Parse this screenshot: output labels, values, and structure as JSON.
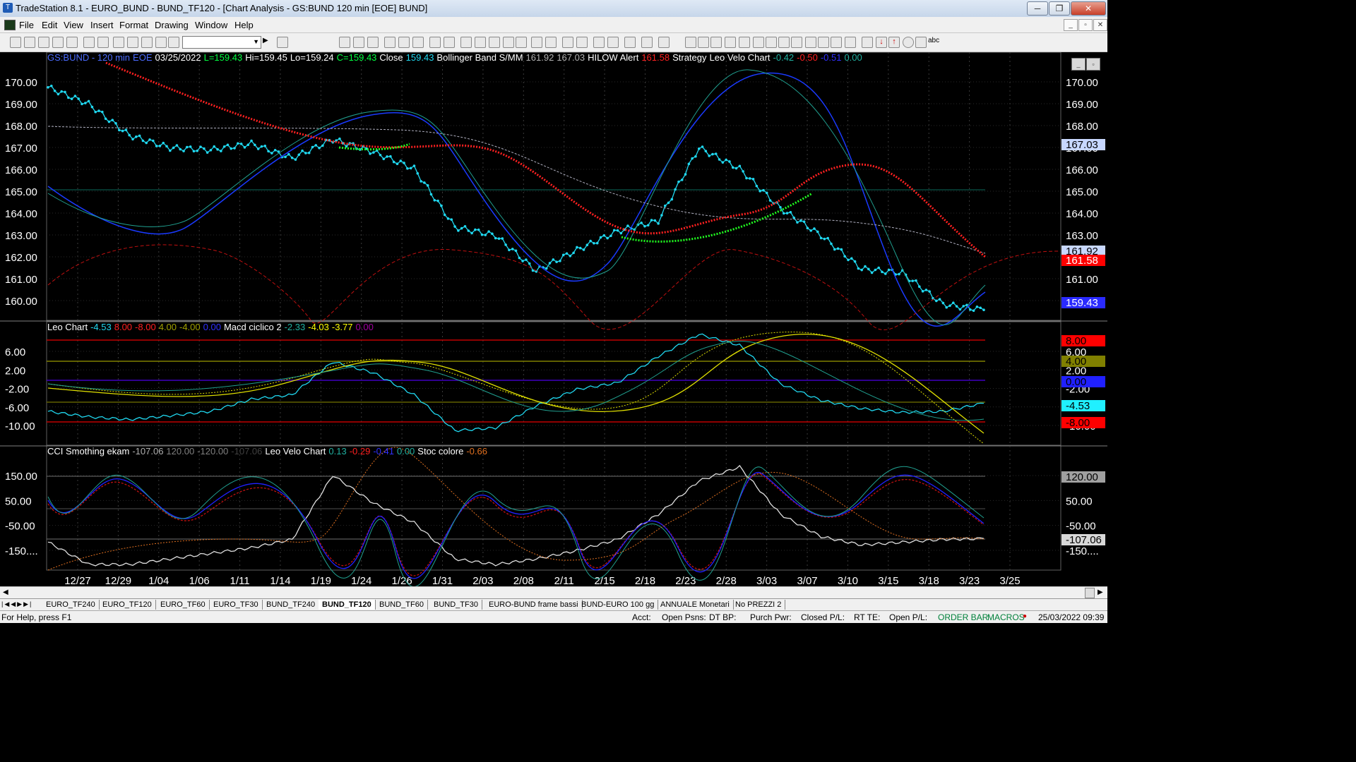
{
  "window": {
    "title": "TradeStation 8.1 - EURO_BUND - BUND_TF120 - [Chart Analysis - GS:BUND  120 min  [EOE] BUND]",
    "minimize": "─",
    "maximize": "❐",
    "close": "✕"
  },
  "menu": [
    "File",
    "Edit",
    "View",
    "Insert",
    "Format",
    "Drawing",
    "Window",
    "Help"
  ],
  "pane1": {
    "legend": [
      {
        "t": "GS:BUND - 120 min",
        "c": "#4a6bff"
      },
      {
        "t": "EOE",
        "c": "#4a6bff"
      },
      {
        "t": "03/25/2022",
        "c": "#ffffff"
      },
      {
        "t": "L=159.43",
        "c": "#00ff40"
      },
      {
        "t": "Hi=159.45",
        "c": "#ffffff"
      },
      {
        "t": "Lo=159.24",
        "c": "#ffffff"
      },
      {
        "t": "C=159.43",
        "c": "#00ff40"
      },
      {
        "t": "Close",
        "c": "#ffffff"
      },
      {
        "t": "159.43",
        "c": "#20d8f0"
      },
      {
        "t": "Bollinger Band S/MM",
        "c": "#ffffff"
      },
      {
        "t": "161.92",
        "c": "#b0b0b0"
      },
      {
        "t": "167.03",
        "c": "#b0b0b0"
      },
      {
        "t": "HILOW Alert",
        "c": "#ffffff"
      },
      {
        "t": "161.58",
        "c": "#ff2020"
      },
      {
        "t": "Strategy",
        "c": "#ffffff"
      },
      {
        "t": "Leo Velo Chart",
        "c": "#ffffff"
      },
      {
        "t": "-0.42",
        "c": "#20b0a0"
      },
      {
        "t": "-0.50",
        "c": "#ff2020"
      },
      {
        "t": "-0.51",
        "c": "#3030ff"
      },
      {
        "t": "0.00",
        "c": "#20b0a0"
      }
    ],
    "axis": [
      "170.00",
      "169.00",
      "168.00",
      "167.00",
      "166.00",
      "165.00",
      "164.00",
      "163.00",
      "162.00",
      "161.00",
      "160.00"
    ],
    "badges": [
      {
        "t": "167.03",
        "bg": "#c8d8ff",
        "fg": "#000000"
      },
      {
        "t": "161.92",
        "bg": "#c8d8ff",
        "fg": "#000000"
      },
      {
        "t": "161.58",
        "bg": "#ff0000",
        "fg": "#ffffff"
      },
      {
        "t": "159.43",
        "bg": "#2a2aff",
        "fg": "#ffffff"
      }
    ]
  },
  "pane2": {
    "legend": [
      {
        "t": "Leo Chart",
        "c": "#ffffff"
      },
      {
        "t": "-4.53",
        "c": "#20d8f0"
      },
      {
        "t": "8.00",
        "c": "#ff2020"
      },
      {
        "t": "-8.00",
        "c": "#ff2020"
      },
      {
        "t": "4.00",
        "c": "#a0a000"
      },
      {
        "t": "-4.00",
        "c": "#a0a000"
      },
      {
        "t": "0.00",
        "c": "#3030ff"
      },
      {
        "t": "Macd ciclico 2",
        "c": "#ffffff"
      },
      {
        "t": "-2.33",
        "c": "#20b0a0"
      },
      {
        "t": "-4.03",
        "c": "#ffff00"
      },
      {
        "t": "-3.77",
        "c": "#ffff00"
      },
      {
        "t": "0.00",
        "c": "#a000a0"
      }
    ],
    "axis": [
      "6.00",
      "2.00",
      "-2.00",
      "-6.00",
      "-10.00"
    ],
    "badges": [
      {
        "t": "8.00",
        "bg": "#ff0000",
        "fg": "#000000"
      },
      {
        "t": "4.00",
        "bg": "#808000",
        "fg": "#000000"
      },
      {
        "t": "0.00",
        "bg": "#2020ff",
        "fg": "#000000"
      },
      {
        "t": "-4.53",
        "bg": "#20f0ff",
        "fg": "#000000"
      },
      {
        "t": "-8.00",
        "bg": "#ff0000",
        "fg": "#000000"
      }
    ]
  },
  "pane3": {
    "legend": [
      {
        "t": "CCI Smothing ekam",
        "c": "#ffffff"
      },
      {
        "t": "-107.06",
        "c": "#b0b0b0"
      },
      {
        "t": "120.00",
        "c": "#808080"
      },
      {
        "t": "-120.00",
        "c": "#808080"
      },
      {
        "t": "-107.06",
        "c": "#404040"
      },
      {
        "t": "Leo Velo Chart",
        "c": "#ffffff"
      },
      {
        "t": "0.13",
        "c": "#20b0a0"
      },
      {
        "t": "-0.29",
        "c": "#ff2020"
      },
      {
        "t": "-0.41",
        "c": "#3030ff"
      },
      {
        "t": "0.00",
        "c": "#20b0a0"
      },
      {
        "t": "Stoc colore",
        "c": "#ffffff"
      },
      {
        "t": "-0.66",
        "c": "#e07020"
      }
    ],
    "axis": [
      "150.00",
      "50.00",
      "-50.00",
      "-150...."
    ],
    "badges": [
      {
        "t": "120.00",
        "bg": "#a0a0a0",
        "fg": "#000000"
      },
      {
        "t": "-107.06",
        "bg": "#d8d8d8",
        "fg": "#000000"
      }
    ]
  },
  "xaxis": [
    "12/27",
    "12/29",
    "1/04",
    "1/06",
    "1/11",
    "1/14",
    "1/19",
    "1/24",
    "1/26",
    "1/31",
    "2/03",
    "2/08",
    "2/11",
    "2/15",
    "2/18",
    "2/23",
    "2/28",
    "3/03",
    "3/07",
    "3/10",
    "3/15",
    "3/18",
    "3/23",
    "3/25"
  ],
  "tabs": [
    "EURO_TF240",
    "EURO_TF120",
    "EURO_TF60",
    "EURO_TF30",
    "BUND_TF240",
    "BUND_TF120",
    "BUND_TF60",
    "BUND_TF30",
    "EURO-BUND frame bassi",
    "BUND-EURO 100 gg",
    "ANNUALE Monetari",
    "No PREZZI 2"
  ],
  "active_tab": "BUND_TF120",
  "status": {
    "help": "For Help, press F1",
    "acct": "Acct:",
    "open_psns": "Open Psns:",
    "dt_bp": "DT BP:",
    "purch_pwr": "Purch Pwr:",
    "closed_pl": "Closed P/L:",
    "rt_te": "RT TE:",
    "open_pl": "Open P/L:",
    "order_bar": "ORDER BAR",
    "macros": "MACROS",
    "datetime": "25/03/2022 09:39"
  },
  "chart_data": [
    {
      "type": "line",
      "title": "GS:BUND - 120 min",
      "x": [
        "12/27",
        "12/29",
        "1/04",
        "1/06",
        "1/11",
        "1/14",
        "1/19",
        "1/24",
        "1/26",
        "1/31",
        "2/03",
        "2/08",
        "2/11",
        "2/15",
        "2/18",
        "2/23",
        "2/28",
        "3/03",
        "3/07",
        "3/10",
        "3/15",
        "3/18",
        "3/23",
        "3/25"
      ],
      "series": [
        {
          "name": "Close",
          "values": [
            170.1,
            169.3,
            167.8,
            167.2,
            167.1,
            167.4,
            166.7,
            167.6,
            167.0,
            166.2,
            163.4,
            163.0,
            161.3,
            162.3,
            163.2,
            163.7,
            167.2,
            166.2,
            164.3,
            163.0,
            161.4,
            161.2,
            159.7,
            159.43
          ]
        }
      ],
      "ylim": [
        159.2,
        170.6
      ]
    },
    {
      "type": "line",
      "title": "Leo Chart",
      "x": [
        "12/27",
        "12/29",
        "1/04",
        "1/06",
        "1/11",
        "1/14",
        "1/19",
        "1/24",
        "1/26",
        "1/31",
        "2/03",
        "2/08",
        "2/11",
        "2/15",
        "2/18",
        "2/23",
        "2/28",
        "3/03",
        "3/07",
        "3/10",
        "3/15",
        "3/18",
        "3/23",
        "3/25"
      ],
      "series": [
        {
          "values": [
            -6.0,
            -7.0,
            -7.5,
            -6.8,
            -6.0,
            -3.8,
            -3.0,
            3.0,
            1.0,
            -3.0,
            -9.5,
            -9.0,
            -5.0,
            -2.0,
            -0.8,
            4.0,
            8.0,
            6.0,
            -1.0,
            -4.0,
            -5.5,
            -6.2,
            -6.0,
            -4.53
          ]
        }
      ],
      "ylim": [
        -11,
        9
      ]
    },
    {
      "type": "line",
      "title": "CCI Smothing ekam",
      "x": [
        "12/27",
        "12/29",
        "1/04",
        "1/06",
        "1/11",
        "1/14",
        "1/19",
        "1/24",
        "1/26",
        "1/31",
        "2/03",
        "2/08",
        "2/11",
        "2/15",
        "2/18",
        "2/23",
        "2/28",
        "3/03",
        "3/07",
        "3/10",
        "3/15",
        "3/18",
        "3/23",
        "3/25"
      ],
      "series": [
        {
          "values": [
            -120,
            -200,
            -200,
            -180,
            -160,
            -140,
            -110,
            120,
            20,
            -50,
            -180,
            -200,
            -180,
            -150,
            -110,
            -20,
            100,
            150,
            -20,
            -100,
            -130,
            -120,
            -110,
            -107.06
          ]
        }
      ],
      "ylim": [
        -210,
        200
      ]
    }
  ]
}
